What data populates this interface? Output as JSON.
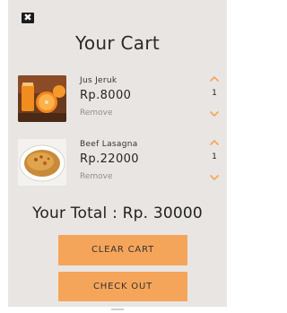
{
  "header": {
    "close_glyph": "✖",
    "title": "Your Cart"
  },
  "cart": {
    "items": [
      {
        "name": "Jus Jeruk",
        "price": "Rp.8000",
        "quantity": "1",
        "remove_label": "Remove",
        "image": "orange-juice-photo"
      },
      {
        "name": "Beef Lasagna",
        "price": "Rp.22000",
        "quantity": "1",
        "remove_label": "Remove",
        "image": "lasagna-photo"
      }
    ]
  },
  "summary": {
    "total_label": "Your Total : Rp. 30000"
  },
  "actions": {
    "clear_label": "CLEAR CART",
    "checkout_label": "CHECK OUT"
  },
  "colors": {
    "background": "#e9e5e2",
    "accent": "#f5a55a",
    "chevron": "#f5a55a"
  }
}
